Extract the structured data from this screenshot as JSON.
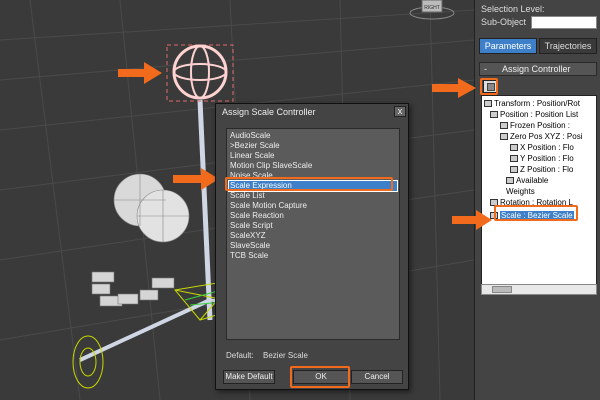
{
  "command_panel": {
    "selection_level_label": "Selection Level:",
    "sub_object_label": "Sub-Object",
    "sub_object_value": "",
    "tabs": [
      {
        "label": "Parameters",
        "active": true
      },
      {
        "label": "Trajectories",
        "active": false
      }
    ],
    "rollout": {
      "collapse_glyph": "-",
      "title": "Assign Controller"
    },
    "tree": [
      {
        "label": "Transform : Position/Rot",
        "selected": false
      },
      {
        "label": "Position : Position List",
        "selected": false
      },
      {
        "label": "Frozen Position :",
        "selected": false
      },
      {
        "label": "Zero Pos XYZ : Posi",
        "selected": false
      },
      {
        "label": "X Position : Flo",
        "selected": false
      },
      {
        "label": "Y Position : Flo",
        "selected": false
      },
      {
        "label": "Z Position : Flo",
        "selected": false
      },
      {
        "label": "Available",
        "selected": false
      },
      {
        "label": "Weights",
        "selected": false
      },
      {
        "label": "Rotation : Rotation L",
        "selected": false
      },
      {
        "label": "Scale : Bezier Scale",
        "selected": true
      }
    ]
  },
  "dialog": {
    "title": "Assign Scale Controller",
    "close_glyph": "x",
    "items": [
      {
        "label": "AudioScale",
        "selected": false
      },
      {
        "label": ">Bezier Scale",
        "selected": false
      },
      {
        "label": "Linear Scale",
        "selected": false
      },
      {
        "label": "Motion Clip SlaveScale",
        "selected": false
      },
      {
        "label": "Noise Scale",
        "selected": false
      },
      {
        "label": "Scale Expression",
        "selected": true
      },
      {
        "label": "Scale List",
        "selected": false
      },
      {
        "label": "Scale Motion Capture",
        "selected": false
      },
      {
        "label": "Scale Reaction",
        "selected": false
      },
      {
        "label": "Scale Script",
        "selected": false
      },
      {
        "label": "ScaleXYZ",
        "selected": false
      },
      {
        "label": "SlaveScale",
        "selected": false
      },
      {
        "label": "TCB Scale",
        "selected": false
      }
    ],
    "default_label": "Default:",
    "default_value": "Bezier Scale",
    "buttons": {
      "make_default": "Make Default",
      "ok": "OK",
      "cancel": "Cancel"
    }
  },
  "viewport": {
    "viewcube_label": "RIGHT"
  },
  "colors": {
    "highlight": "#f26a1b",
    "selection": "#3d7fc8",
    "panel": "#444444",
    "viewport": "#3a3a3a"
  }
}
